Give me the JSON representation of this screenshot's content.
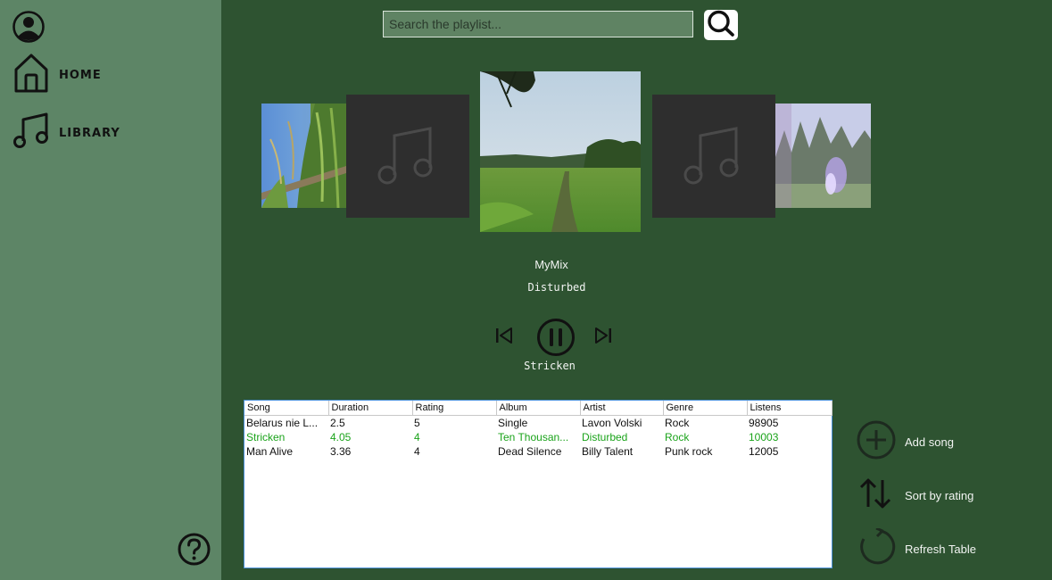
{
  "sidebar": {
    "nav": [
      {
        "label": "HOME",
        "icon": "home-icon"
      },
      {
        "label": "LIBRARY",
        "icon": "music-note-icon"
      }
    ],
    "profile_icon": "user-circle-icon",
    "help_icon": "help-circle-icon"
  },
  "search": {
    "placeholder": "Search the playlist...",
    "value": "",
    "button_icon": "search-icon"
  },
  "carousel": {
    "covers": [
      "grass-photo",
      "music-placeholder",
      "meadow-photo",
      "music-placeholder",
      "forest-photo"
    ]
  },
  "player": {
    "playlist_name": "MyMix",
    "playlist_artist": "Disturbed",
    "now_playing": "Stricken",
    "icons": [
      "skip-previous-icon",
      "pause-icon",
      "skip-next-icon"
    ]
  },
  "table": {
    "columns": [
      "Song",
      "Duration",
      "Rating",
      "Album",
      "Artist",
      "Genre",
      "Listens"
    ],
    "rows": [
      [
        "Belarus nie L...",
        "2.5",
        "5",
        "Single",
        "Lavon Volski",
        "Rock",
        "98905"
      ],
      [
        "Stricken",
        "4.05",
        "4",
        "Ten Thousan...",
        "Disturbed",
        "Rock",
        "10003"
      ],
      [
        "Man Alive",
        "3.36",
        "4",
        "Dead Silence",
        "Billy Talent",
        "Punk rock",
        "12005"
      ]
    ],
    "active_row": 1
  },
  "actions": [
    {
      "label": "Add song",
      "icon": "add-circle-icon"
    },
    {
      "label": "Sort by rating",
      "icon": "sort-arrows-icon"
    },
    {
      "label": "Refresh Table",
      "icon": "refresh-icon"
    }
  ],
  "colors": {
    "sidebar": "#5d8566",
    "main": "#2e5331",
    "active_row": "#1aa31a"
  }
}
